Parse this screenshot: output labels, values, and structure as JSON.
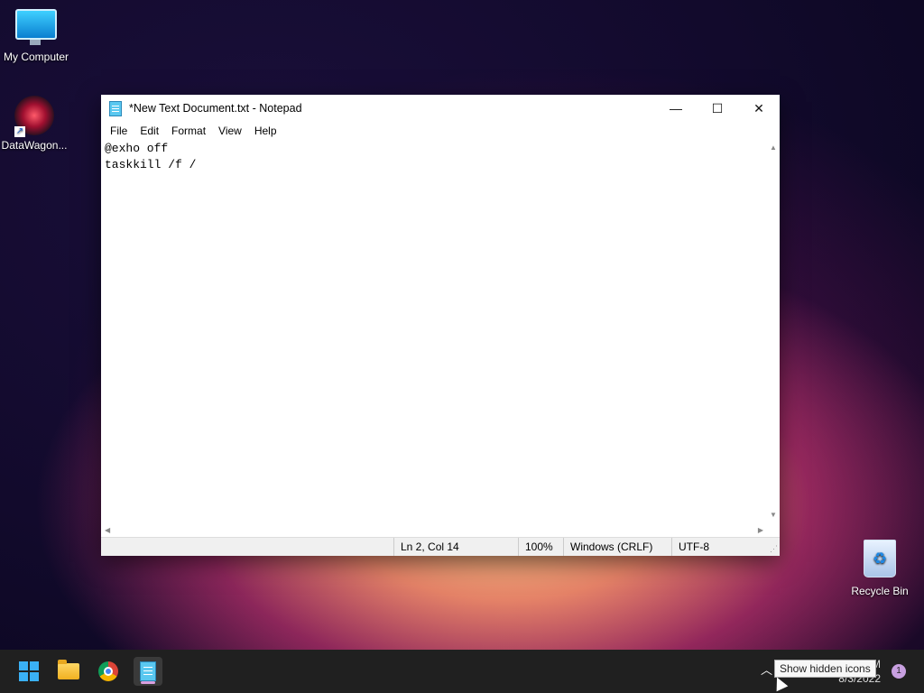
{
  "desktop": {
    "icons": [
      {
        "label": "My Computer"
      },
      {
        "label": "DataWagon..."
      },
      {
        "label": "Recycle Bin"
      }
    ]
  },
  "notepad": {
    "title": "*New Text Document.txt - Notepad",
    "controls": {
      "minimize": "—",
      "maximize": "☐",
      "close": "✕"
    },
    "menu": [
      "File",
      "Edit",
      "Format",
      "View",
      "Help"
    ],
    "content": "@exho off\ntaskkill /f /",
    "status": {
      "position": "Ln 2, Col 14",
      "zoom": "100%",
      "line_endings": "Windows (CRLF)",
      "encoding": "UTF-8"
    }
  },
  "taskbar": {
    "tooltip": "Show hidden icons",
    "clock": {
      "time": "M",
      "date": "8/3/2022"
    },
    "notification_count": "1",
    "accent_color": "#d9a0e0"
  }
}
